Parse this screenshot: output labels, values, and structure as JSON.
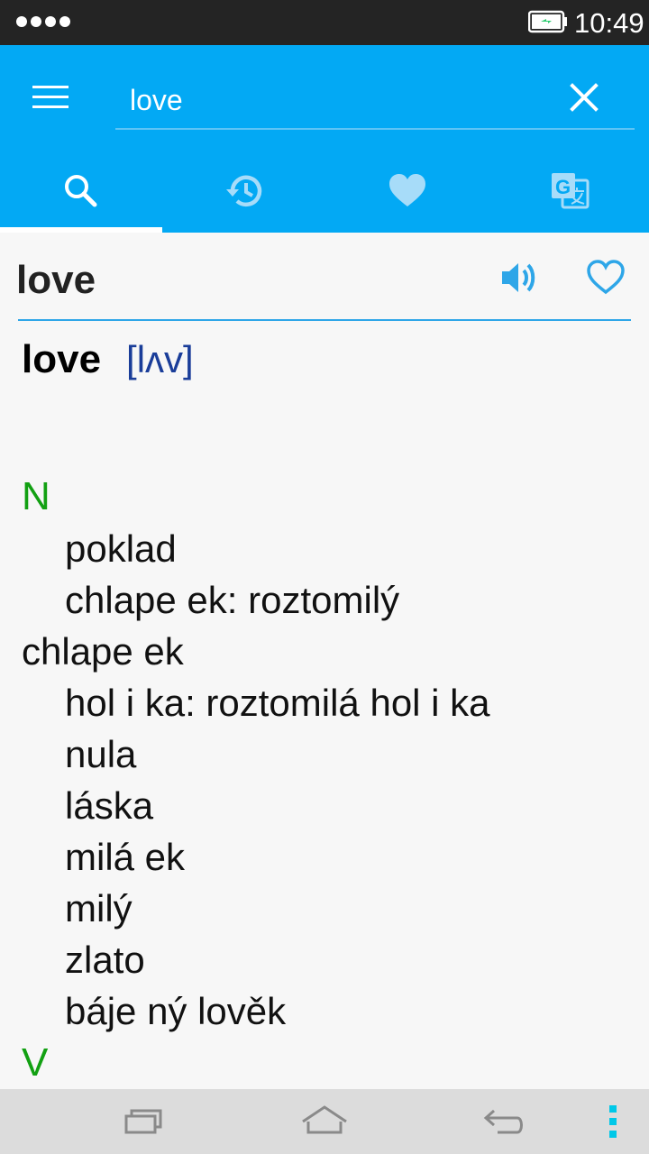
{
  "status_bar": {
    "time": "10:49",
    "signal_icon": "signal-dots-icon",
    "battery_icon": "battery-charging-icon"
  },
  "toolbar": {
    "menu_icon": "hamburger-menu-icon",
    "search_value": "love",
    "clear_icon": "close-icon"
  },
  "tabs": [
    {
      "name": "search",
      "icon": "search-icon",
      "active": true
    },
    {
      "name": "history",
      "icon": "history-icon",
      "active": false
    },
    {
      "name": "favorites",
      "icon": "heart-icon",
      "active": false
    },
    {
      "name": "translate",
      "icon": "translate-icon",
      "active": false
    }
  ],
  "result": {
    "word": "love",
    "speaker_icon": "speaker-icon",
    "favorite_icon": "heart-outline-icon",
    "entry": {
      "term": "love",
      "pronunciation": "[lʌv]",
      "pos_noun": "N",
      "pos_verb": "V",
      "lines": [
        {
          "text": "poklad",
          "indent": true
        },
        {
          "text": "chlape ek: roztomilý",
          "indent": true
        },
        {
          "text": "chlape ek",
          "indent": false
        },
        {
          "text": "hol i ka: roztomilá hol i ka",
          "indent": true
        },
        {
          "text": "nula",
          "indent": true
        },
        {
          "text": "láska",
          "indent": true
        },
        {
          "text": "milá ek",
          "indent": true
        },
        {
          "text": "milý",
          "indent": true
        },
        {
          "text": "zlato",
          "indent": true
        },
        {
          "text": "báje ný  lověk",
          "indent": true
        }
      ]
    }
  },
  "nav_bar": {
    "recents_icon": "recent-apps-icon",
    "home_icon": "home-icon",
    "back_icon": "back-icon",
    "more_icon": "more-vertical-icon"
  },
  "colors": {
    "app_bar": "#03a9f4",
    "accent": "#2ea6e8",
    "pos_label": "#12a012",
    "pronunciation": "#1a3d99"
  }
}
